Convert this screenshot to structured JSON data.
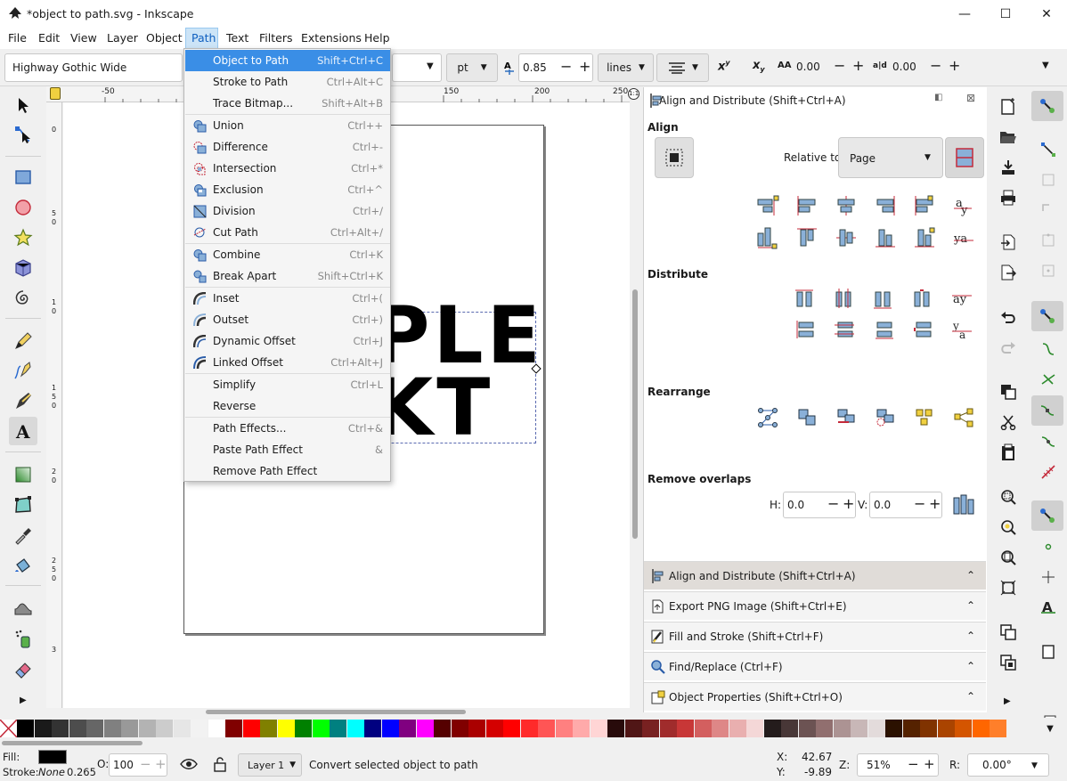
{
  "window": {
    "title": "*object to path.svg - Inkscape",
    "controls": [
      "minimize-icon",
      "maximize-icon",
      "close-icon"
    ]
  },
  "menubar": [
    "File",
    "Edit",
    "View",
    "Layer",
    "Object",
    "Path",
    "Text",
    "Filters",
    "Extensions",
    "Help"
  ],
  "toolbar": {
    "font_family": "Highway Gothic Wide",
    "unit": "pt",
    "line_height": "0.85",
    "line_spacing_unit": "lines",
    "letter_spacing": "0.00",
    "word_spacing": "0.00"
  },
  "ruler": {
    "top_labels": [
      "-50",
      "150",
      "200",
      "250"
    ],
    "left_labels": [
      "0",
      "5",
      "0",
      "1",
      "0",
      "1",
      "5",
      "0",
      "2",
      "0",
      "2",
      "5",
      "0",
      "3"
    ]
  },
  "canvas": {
    "text_line1": "PLE",
    "text_line2": "KT"
  },
  "path_menu": {
    "groups": [
      [
        {
          "label": "Object to Path",
          "shortcut": "Shift+Ctrl+C",
          "icon": "",
          "selected": true
        },
        {
          "label": "Stroke to Path",
          "shortcut": "Ctrl+Alt+C",
          "icon": ""
        },
        {
          "label": "Trace Bitmap...",
          "shortcut": "Shift+Alt+B",
          "icon": ""
        }
      ],
      [
        {
          "label": "Union",
          "shortcut": "Ctrl++",
          "icon": "union-icon"
        },
        {
          "label": "Difference",
          "shortcut": "Ctrl+-",
          "icon": "difference-icon"
        },
        {
          "label": "Intersection",
          "shortcut": "Ctrl+*",
          "icon": "intersection-icon"
        },
        {
          "label": "Exclusion",
          "shortcut": "Ctrl+^",
          "icon": "exclusion-icon"
        },
        {
          "label": "Division",
          "shortcut": "Ctrl+/",
          "icon": "division-icon"
        },
        {
          "label": "Cut Path",
          "shortcut": "Ctrl+Alt+/",
          "icon": "cut-path-icon"
        }
      ],
      [
        {
          "label": "Combine",
          "shortcut": "Ctrl+K",
          "icon": "combine-icon"
        },
        {
          "label": "Break Apart",
          "shortcut": "Shift+Ctrl+K",
          "icon": "break-apart-icon"
        }
      ],
      [
        {
          "label": "Inset",
          "shortcut": "Ctrl+(",
          "icon": "inset-icon"
        },
        {
          "label": "Outset",
          "shortcut": "Ctrl+)",
          "icon": "outset-icon"
        },
        {
          "label": "Dynamic Offset",
          "shortcut": "Ctrl+J",
          "icon": "dynamic-offset-icon"
        },
        {
          "label": "Linked Offset",
          "shortcut": "Ctrl+Alt+J",
          "icon": "linked-offset-icon"
        }
      ],
      [
        {
          "label": "Simplify",
          "shortcut": "Ctrl+L",
          "icon": ""
        },
        {
          "label": "Reverse",
          "shortcut": "",
          "icon": ""
        }
      ],
      [
        {
          "label": "Path Effects...",
          "shortcut": "Ctrl+&",
          "icon": ""
        },
        {
          "label": "Paste Path Effect",
          "shortcut": "&",
          "icon": ""
        },
        {
          "label": "Remove Path Effect",
          "shortcut": "",
          "icon": ""
        }
      ]
    ]
  },
  "align_dialog": {
    "header": "Align and Distribute (Shift+Ctrl+A)",
    "align_title": "Align",
    "relative_to_label": "Relative to:",
    "relative_to_value": "Page",
    "distribute_title": "Distribute",
    "rearrange_title": "Rearrange",
    "remove_overlaps_title": "Remove overlaps",
    "h_label": "H:",
    "h_value": "0.0",
    "v_label": "V:",
    "v_value": "0.0"
  },
  "dock_panels": [
    {
      "label": "Align and Distribute (Shift+Ctrl+A)",
      "icon": "align-icon",
      "active": true
    },
    {
      "label": "Export PNG Image (Shift+Ctrl+E)",
      "icon": "export-icon"
    },
    {
      "label": "Fill and Stroke (Shift+Ctrl+F)",
      "icon": "fill-stroke-icon"
    },
    {
      "label": "Find/Replace (Ctrl+F)",
      "icon": "find-icon"
    },
    {
      "label": "Object Properties (Shift+Ctrl+O)",
      "icon": "object-properties-icon"
    }
  ],
  "palette": [
    "#000000",
    "#1a1a1a",
    "#333333",
    "#4d4d4d",
    "#666666",
    "#808080",
    "#999999",
    "#b3b3b3",
    "#cccccc",
    "#e6e6e6",
    "#f2f2f2",
    "#ffffff",
    "#800000",
    "#ff0000",
    "#808000",
    "#ffff00",
    "#008000",
    "#00ff00",
    "#008080",
    "#00ffff",
    "#000080",
    "#0000ff",
    "#800080",
    "#ff00ff",
    "#550000",
    "#800000",
    "#aa0000",
    "#d40000",
    "#ff0000",
    "#ff2a2a",
    "#ff5555",
    "#ff8080",
    "#ffaaaa",
    "#ffd5d5",
    "#280b0b",
    "#501616",
    "#782121",
    "#a02c2c",
    "#c83737",
    "#d35f5f",
    "#de8787",
    "#e9afaf",
    "#f4d7d7",
    "#241c1c",
    "#483737",
    "#6c5353",
    "#916f6f",
    "#ac9393",
    "#c8b7b7",
    "#e3dbdb",
    "#2b1100",
    "#552200",
    "#803300",
    "#aa4400",
    "#d45500",
    "#ff6600",
    "#ff7f2a"
  ],
  "status": {
    "fill_label": "Fill:",
    "fill_color": "#000000",
    "stroke_label": "Stroke:",
    "stroke_value": "None",
    "stroke_width": "0.265",
    "opacity_label": "O:",
    "opacity_value": "100",
    "layer": "Layer 1",
    "message": "Convert selected object to path",
    "x_label": "X:",
    "x_value": "42.67",
    "y_label": "Y:",
    "y_value": "-9.89",
    "zoom_label": "Z:",
    "zoom_value": "51%",
    "rotation_label": "R:",
    "rotation_value": "0.00°"
  }
}
